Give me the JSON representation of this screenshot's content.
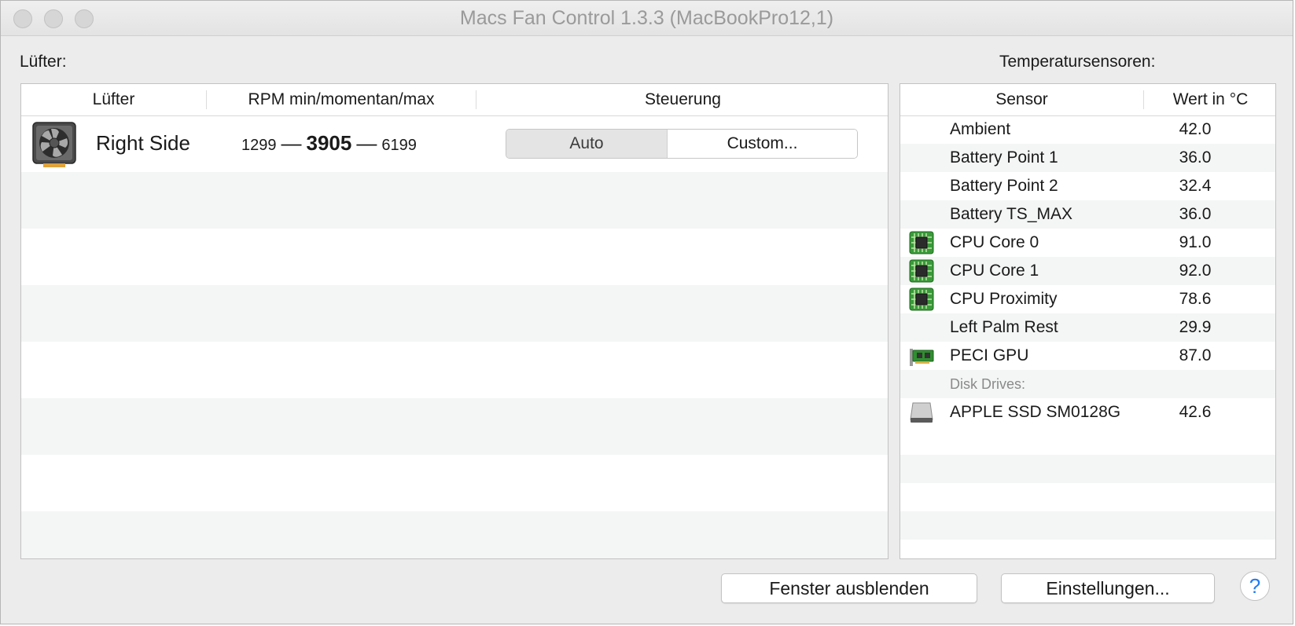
{
  "window": {
    "title": "Macs Fan Control 1.3.3 (MacBookPro12,1)"
  },
  "fans": {
    "section_label": "Lüfter:",
    "columns": [
      "Lüfter",
      "RPM min/momentan/max",
      "Steuerung"
    ],
    "rows": [
      {
        "name": "Right Side",
        "rpm_min": "1299",
        "rpm_current": "3905",
        "rpm_max": "6199",
        "separator": "—",
        "control_options": [
          "Auto",
          "Custom..."
        ],
        "control_selected": "Auto",
        "icon": "fan-icon"
      }
    ]
  },
  "sensors": {
    "section_label": "Temperatursensoren:",
    "columns": [
      "Sensor",
      "Wert in °C"
    ],
    "rows": [
      {
        "name": "Ambient",
        "value": "42.0",
        "icon": ""
      },
      {
        "name": "Battery Point 1",
        "value": "36.0",
        "icon": ""
      },
      {
        "name": "Battery Point 2",
        "value": "32.4",
        "icon": ""
      },
      {
        "name": "Battery TS_MAX",
        "value": "36.0",
        "icon": ""
      },
      {
        "name": "CPU Core 0",
        "value": "91.0",
        "icon": "cpu-chip-icon"
      },
      {
        "name": "CPU Core 1",
        "value": "92.0",
        "icon": "cpu-chip-icon"
      },
      {
        "name": "CPU Proximity",
        "value": "78.6",
        "icon": "cpu-chip-icon"
      },
      {
        "name": "Left Palm Rest",
        "value": "29.9",
        "icon": ""
      },
      {
        "name": "PECI GPU",
        "value": "87.0",
        "icon": "gpu-card-icon"
      }
    ],
    "disk_group_label": "Disk Drives:",
    "disk_rows": [
      {
        "name": "APPLE SSD SM0128G",
        "value": "42.6",
        "icon": "hard-drive-icon"
      }
    ]
  },
  "footer": {
    "hide_window_label": "Fenster ausblenden",
    "settings_label": "Einstellungen...",
    "help_label": "?"
  },
  "colors": {
    "window_bg": "#ececec",
    "stripe": "#f4f5f5",
    "help_accent": "#1e7cf2",
    "cpu_chip": "#3a9a3a"
  }
}
